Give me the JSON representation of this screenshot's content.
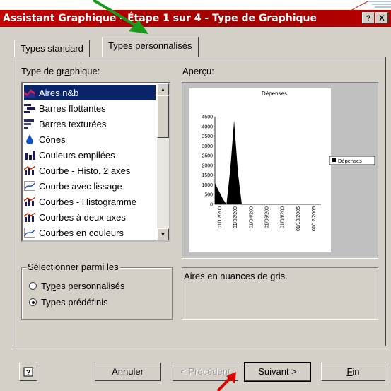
{
  "window": {
    "title": "Assistant Graphique - Étape 1 sur 4 - Type de Graphique",
    "help_btn": "?",
    "close_btn": "X"
  },
  "tabs": [
    {
      "label": "Types standard",
      "active": false
    },
    {
      "label": "Types personnalisés",
      "active": true
    }
  ],
  "chart_type": {
    "label": "Type de graphique:",
    "items": [
      {
        "label": "Aires n&b",
        "icon": "area-chart-icon",
        "selected": true
      },
      {
        "label": "Barres flottantes",
        "icon": "floating-bar-icon",
        "selected": false
      },
      {
        "label": "Barres texturées",
        "icon": "textured-bar-icon",
        "selected": false
      },
      {
        "label": "Cônes",
        "icon": "cone-icon",
        "selected": false
      },
      {
        "label": "Couleurs empilées",
        "icon": "stacked-column-icon",
        "selected": false
      },
      {
        "label": "Courbe - Histo. 2 axes",
        "icon": "line-column-icon",
        "selected": false
      },
      {
        "label": "Courbe avec lissage",
        "icon": "smooth-line-icon",
        "selected": false
      },
      {
        "label": "Courbes - Histogramme",
        "icon": "line-column-icon",
        "selected": false
      },
      {
        "label": "Courbes à deux axes",
        "icon": "line-column-icon",
        "selected": false
      },
      {
        "label": "Courbes en couleurs",
        "icon": "smooth-line-icon",
        "selected": false
      }
    ]
  },
  "preview": {
    "label": "Aperçu:",
    "legend": "Dépenses"
  },
  "chart_data": {
    "type": "area",
    "title": "Dépenses",
    "xlabel": "",
    "ylabel": "",
    "ylim": [
      0,
      4500
    ],
    "yticks": [
      "4500",
      "4000",
      "3500",
      "3000",
      "2500",
      "2000",
      "1500",
      "1000",
      "500",
      "0"
    ],
    "xticks": [
      "01/12/200",
      "01/02/200",
      "01/04/200",
      "01/06/200",
      "01/08/200",
      "01/10/2005",
      "01/12/2005"
    ],
    "series": [
      {
        "name": "Dépenses",
        "values": [
          1100,
          700,
          300,
          0,
          1800,
          4300,
          1600,
          0
        ]
      }
    ],
    "legend_position": "right"
  },
  "select_from": {
    "label": "Sélectionner parmi les",
    "options": [
      {
        "label": "Types personnalisés",
        "checked": false
      },
      {
        "label": "Types prédéfinis",
        "checked": true
      }
    ]
  },
  "description": "Aires en nuances de gris.",
  "buttons": {
    "help": "?",
    "cancel": "Annuler",
    "previous": "< Précédent",
    "next": "Suivant >",
    "finish": "Fin"
  }
}
